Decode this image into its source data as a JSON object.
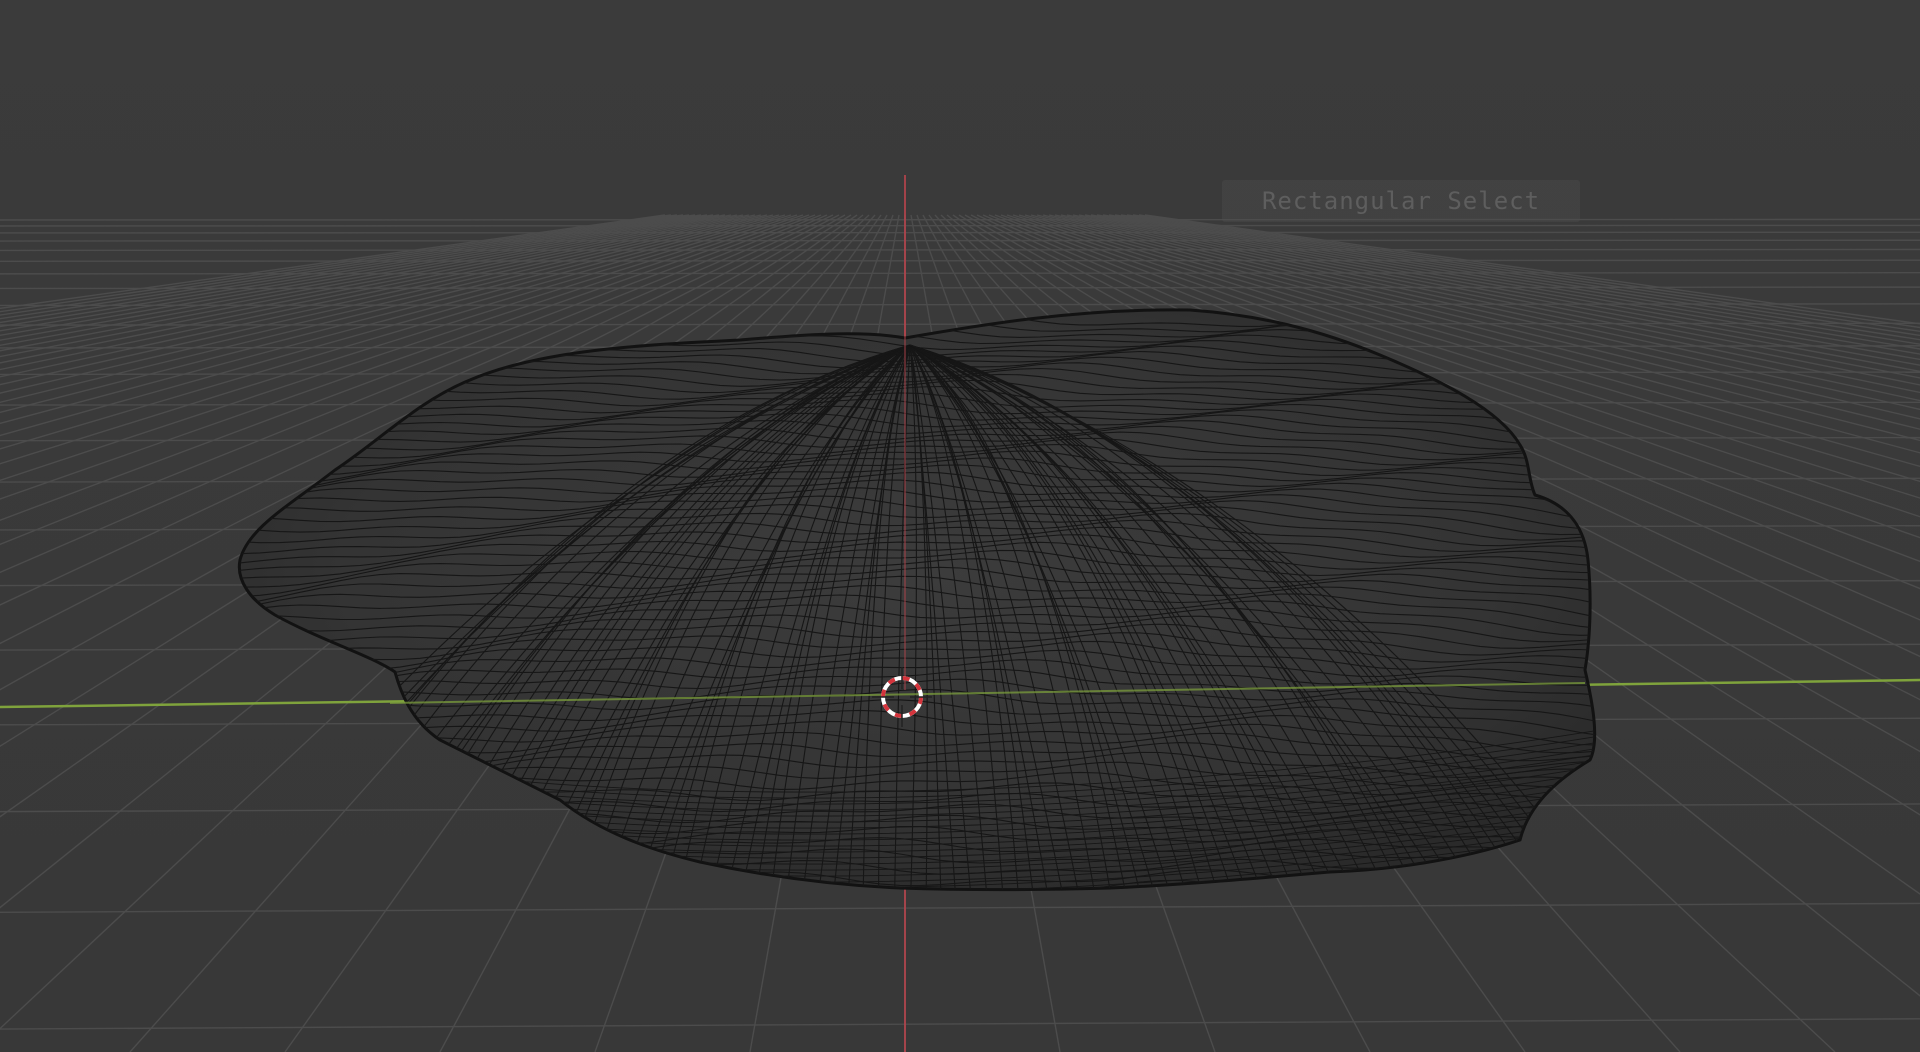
{
  "viewport": {
    "view": "3D Viewport",
    "shading": "wireframe",
    "background_color": "#3a3a3a",
    "grid_color": "#4c4c4c",
    "x_axis_color": "#b5444c",
    "y_axis_color": "#7fa33c",
    "mesh_wire_color": "#141414",
    "cursor_colors": [
      "#d4343c",
      "#ffffff"
    ]
  },
  "tooltip": {
    "text": "Rectangular Select"
  },
  "icons": {
    "cursor": "3d-cursor-icon"
  }
}
